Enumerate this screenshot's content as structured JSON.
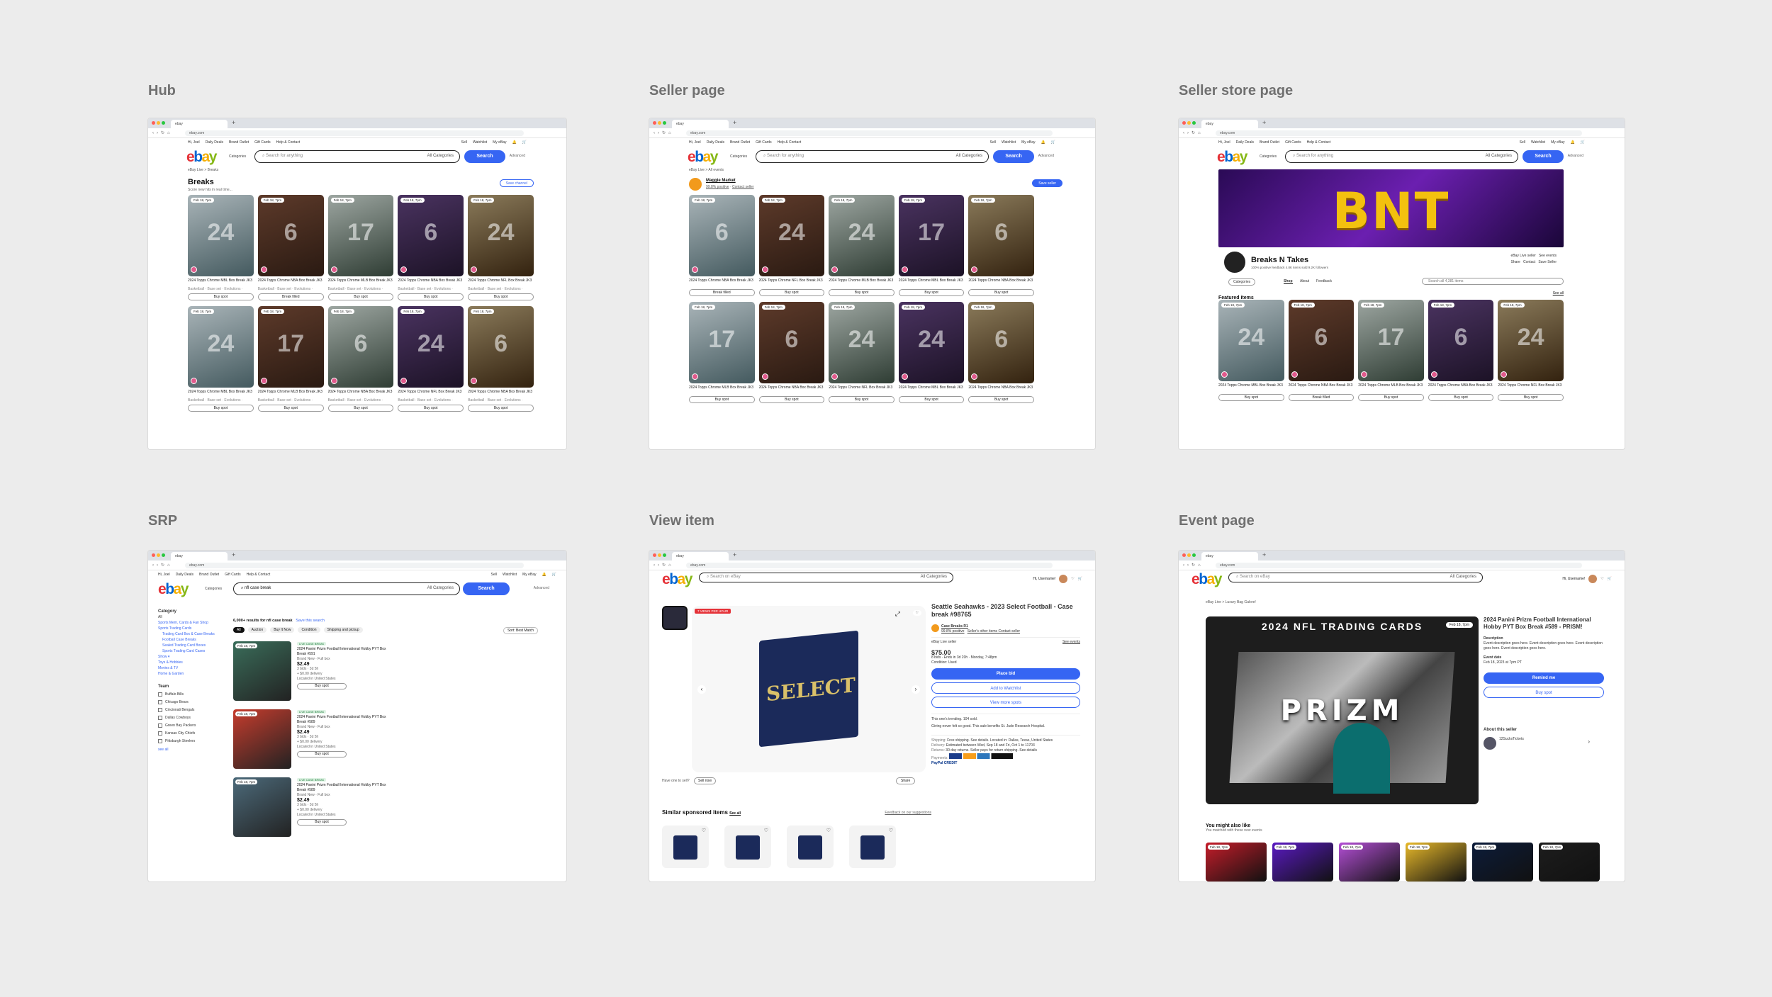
{
  "sections": {
    "hub": "Hub",
    "seller_page": "Seller page",
    "seller_store_page": "Seller store page",
    "srp": "SRP",
    "view_item": "View item",
    "event_page": "Event page"
  },
  "browser": {
    "tab_label": "ebay",
    "url": "ebay.com"
  },
  "ebay": {
    "greeting": "Hi, Joel",
    "top_left_links": [
      "Daily Deals",
      "Brand Outlet",
      "Gift Cards",
      "Help & Contact"
    ],
    "top_right_links": [
      "Sell",
      "Watchlist",
      "My eBay"
    ],
    "categories": "Categories",
    "search_placeholder": "Search for anything",
    "all_categories": "All Categories",
    "search_button": "Search",
    "advanced": "Advanced"
  },
  "hub": {
    "breadcrumb": "eBay Live  >  Breaks",
    "title": "Breaks",
    "subtitle": "Score new hits in real time...",
    "save_button": "Save channel",
    "date_chip": "Feb 18, 7pm",
    "cards": [
      {
        "title": "2024 Topps Chrome MBL Box Break JK3",
        "meta": "Basketball · Base set · Evolutions · Breaks",
        "button": "Buy spot",
        "num": "24"
      },
      {
        "title": "2024 Topps Chrome NBA Box Break JK3",
        "meta": "Basketball · Base set · Evolutions · Breaks",
        "button": "Break filled",
        "num": "6"
      },
      {
        "title": "2024 Topps Chrome MLB Box Break JK3",
        "meta": "Basketball · Base set · Evolutions · Breaks",
        "button": "Buy spot",
        "num": "17"
      },
      {
        "title": "2024 Topps Chrome NBA Box Break JK3",
        "meta": "Basketball · Base set · Evolutions · Breaks",
        "button": "Buy spot",
        "num": "6"
      },
      {
        "title": "2024 Topps Chrome NFL Box Break JK3",
        "meta": "Basketball · Base set · Evolutions · Breaks",
        "button": "Buy spot",
        "num": "24"
      },
      {
        "title": "2024 Topps Chrome MBL Box Break JK3",
        "meta": "Basketball · Base set · Evolutions · Breaks",
        "button": "Buy spot",
        "num": "24"
      },
      {
        "title": "2024 Topps Chrome MLB Box Break JK3",
        "meta": "Basketball · Base set · Evolutions · Breaks",
        "button": "Buy spot",
        "num": "17"
      },
      {
        "title": "2024 Topps Chrome NBA Box Break JK3",
        "meta": "Basketball · Base set · Evolutions · Breaks",
        "button": "Buy spot",
        "num": "6"
      },
      {
        "title": "2024 Topps Chrome NFL Box Break JK3",
        "meta": "Basketball · Base set · Evolutions · Breaks",
        "button": "Buy spot",
        "num": "24"
      },
      {
        "title": "2024 Topps Chrome NBA Box Break JK3",
        "meta": "Basketball · Base set · Evolutions · Breaks",
        "button": "Buy spot",
        "num": "6"
      }
    ]
  },
  "seller": {
    "breadcrumb": "eBay Live  >  All events",
    "name": "Maggie Market",
    "rating": "99.8% positive",
    "contact": "Contact seller",
    "save_button": "Save seller",
    "cards": [
      {
        "title": "2024 Topps Chrome NBA Box Break JK3",
        "button": "Break filled",
        "num": "6"
      },
      {
        "title": "2024 Topps Chrome NFL Box Break JK3",
        "button": "Buy spot",
        "num": "24"
      },
      {
        "title": "2024 Topps Chrome MLB Box Break JK3",
        "button": "Buy spot",
        "num": "24"
      },
      {
        "title": "2024 Topps Chrome MBL Box Break JK3",
        "button": "Buy spot",
        "num": "17"
      },
      {
        "title": "2024 Topps Chrome NBA Box Break JK3",
        "button": "Buy spot",
        "num": "6"
      },
      {
        "title": "2024 Topps Chrome MLB Box Break JK3",
        "button": "Buy spot",
        "num": "17"
      },
      {
        "title": "2024 Topps Chrome NBA Box Break JK3",
        "button": "Buy spot",
        "num": "6"
      },
      {
        "title": "2024 Topps Chrome NFL Box Break JK3",
        "button": "Buy spot",
        "num": "24"
      },
      {
        "title": "2024 Topps Chrome MBL Box Break JK3",
        "button": "Buy spot",
        "num": "24"
      },
      {
        "title": "2024 Topps Chrome NBA Box Break JK3",
        "button": "Buy spot",
        "num": "6"
      }
    ]
  },
  "store": {
    "banner_text": "BNT",
    "name": "Breaks N Takes",
    "stats": "100% positive feedback   4.8K items sold   9.2K followers",
    "live_badge": "eBay Live seller",
    "see_events": "See events",
    "share": "Share",
    "contact": "Contact",
    "save": "Save Seller",
    "tabs": [
      "Categories",
      "Shop",
      "About",
      "Feedback"
    ],
    "store_search": "Search all 4,381 items",
    "featured": "Featured items",
    "see_all": "See all",
    "cards": [
      {
        "title": "2024 Topps Chrome MBL Box Break JK3",
        "button": "Buy spot",
        "num": "24"
      },
      {
        "title": "2024 Topps Chrome NBA Box Break JK3",
        "button": "Break filled",
        "num": "6"
      },
      {
        "title": "2024 Topps Chrome MLB Box Break JK3",
        "button": "Buy spot",
        "num": "17"
      },
      {
        "title": "2024 Topps Chrome NBA Box Break JK3",
        "button": "Buy spot",
        "num": "6"
      },
      {
        "title": "2024 Topps Chrome NFL Box Break JK3",
        "button": "Buy spot",
        "num": "24"
      }
    ]
  },
  "srp": {
    "query": "nfl case break",
    "results": "6,000+ results for nfl case break",
    "save_search": "Save this search",
    "filters": [
      "All",
      "Auction",
      "Buy It Now",
      "Condition",
      "Shipping and pickup"
    ],
    "sort": "Sort: Best Match",
    "sidebar_heading": "Category",
    "sidebar_items": [
      "All",
      "Sports Mem, Cards & Fan Shop",
      "Sports Trading Cards",
      "Trading Card Box & Case Breaks",
      "Football Case Breaks",
      "Sealed Trading Card Boxes",
      "Sports Trading Card Cases",
      "Show ▾",
      "Toys & Hobbies",
      "Movies & TV",
      "Home & Garden"
    ],
    "team_heading": "Team",
    "teams": [
      "Buffalo Bills",
      "Chicago Bears",
      "Cincinnati Bengals",
      "Dallas Cowboys",
      "Green Bay Packers",
      "Kansas City Chiefs",
      "Pittsburgh Steelers"
    ],
    "see_all": "see all",
    "items": [
      {
        "badge": "LIVE CASE BREAK",
        "title": "2024 Panini Prizm Football International Hobby PYT Box Break #591",
        "condition": "Brand New · Full box",
        "price": "$2.49",
        "bids": "3 bids · 3d 5h",
        "shipping": "+ $0.00 delivery",
        "location": "Located in United States",
        "button": "Buy spot"
      },
      {
        "badge": "LIVE CASE BREAK",
        "title": "2024 Panini Prizm Football International Hobby PYT Box Break #589",
        "condition": "Brand New · Full box",
        "price": "$2.49",
        "bids": "3 bids · 3d 5h",
        "shipping": "+ $0.00 delivery",
        "location": "Located in United States",
        "button": "Buy spot"
      },
      {
        "badge": "LIVE CASE BREAK",
        "title": "2024 Panini Prizm Football International Hobby PYT Box Break #589",
        "condition": "Brand New · Full box",
        "price": "$2.49",
        "bids": "3 bids · 3d 5h",
        "shipping": "+ $0.00 delivery",
        "location": "Located in United States",
        "button": "Buy spot"
      }
    ]
  },
  "view_item": {
    "search_placeholder": "Search on eBay",
    "user": "Hi, Username!",
    "title": "Seattle Seahawks - 2023 Select Football - Case break #98765",
    "seller": "Case Breaks R1",
    "seller_rating": "99.8% positive",
    "seller_links": "Seller's other items   Contact seller",
    "live_label": "eBay Live seller",
    "see_events": "See events",
    "price": "$75.00",
    "bids": "8 bids · Ends in 3d 20h · Monday, 7:48pm",
    "condition": "Condition: Used",
    "place_bid": "Place bid",
    "add_watchlist": "Add to Watchlist",
    "view_more": "View more spots",
    "trending": "This one's trending. 104 sold.",
    "giving": "Giving never felt so good. This sale benefits St. Jude Research Hospital.",
    "box_label": "SELECT",
    "have_one": "Have one to sell?",
    "sell_now": "Sell now",
    "share": "Share",
    "shipping_label": "Shipping:",
    "shipping": "Free shipping. See details. Located in: Dallas, Texas, United States",
    "delivery_label": "Delivery:",
    "delivery": "Estimated between Wed, Sep 18 and Fri, Oct 1 to 11703",
    "returns_label": "Returns:",
    "returns": "30 day returns. Seller pays for return shipping. See details",
    "payments_label": "Payments:",
    "paypal_credit": "PayPal CREDIT",
    "similar": "Similar sponsored items",
    "see_all": "See all",
    "feedback": "Feedback on our suggestions",
    "ribbon": "7 VIEWS PER HOUR"
  },
  "event": {
    "search_placeholder": "Search on eBay",
    "user": "Hi, Username!",
    "breadcrumb": "eBay Live  >  Luxury Bag Galore!",
    "img_heading": "2024 NFL TRADING CARDS",
    "img_brand": "PRIZM",
    "title": "2024 Panini Prizm Football International Hobby PYT Box Break #589 - PRISM!",
    "desc_label": "Description",
    "description": "Event description goes here. Event description goes here. Event description goes here. Event description goes here.",
    "date_label": "Event date",
    "date": "Feb 18, 2023 at 7pm PT",
    "remind": "Remind me",
    "buy_spot": "Buy spot",
    "about": "About this seller",
    "seller": "12SucksTickets",
    "also_like": "You might also like",
    "also_sub": "You matched with these new events",
    "date_chip": "Feb 18, 7pm"
  },
  "colors": {
    "ebay_blue": "#3665f3",
    "ebay_red": "#e53238",
    "ebay_yellow": "#f5af02",
    "ebay_green": "#86b817",
    "background": "#ececec"
  }
}
